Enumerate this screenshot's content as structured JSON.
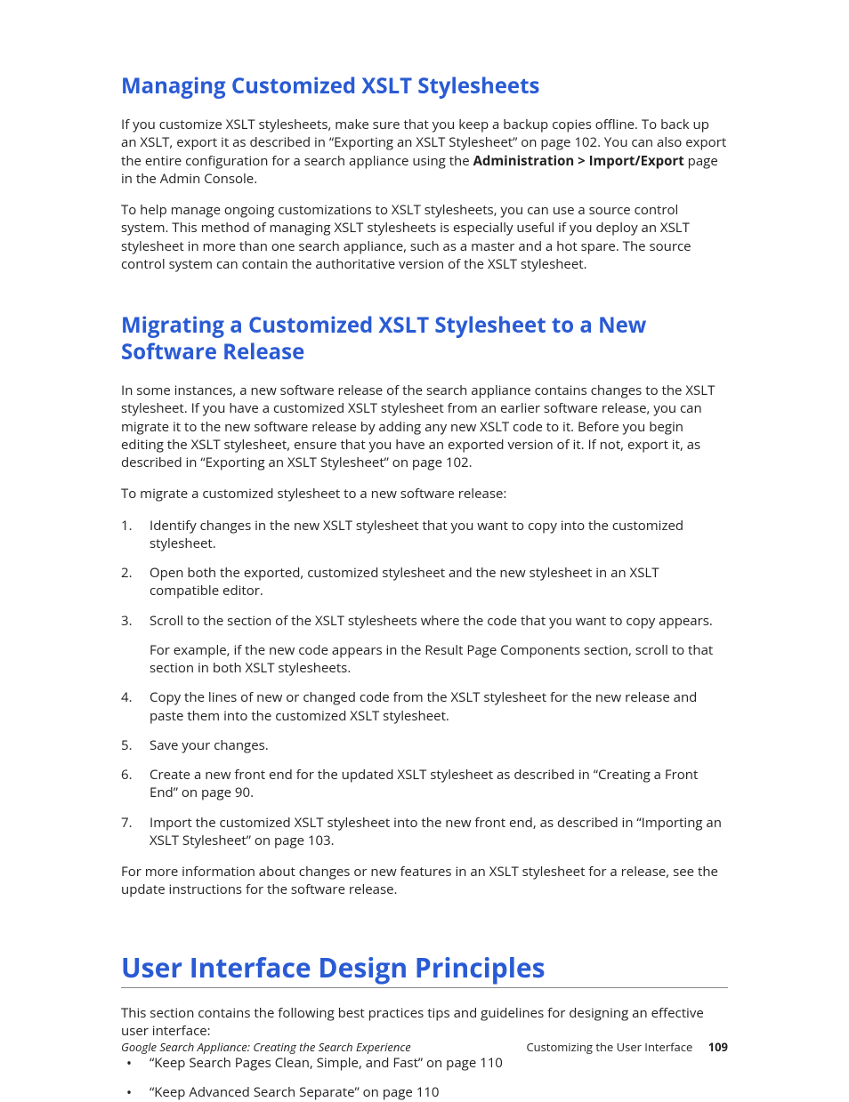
{
  "section1": {
    "heading": "Managing Customized XSLT Stylesheets",
    "para1_a": "If you customize XSLT stylesheets, make sure that you keep a backup copies offline. To back up an XSLT, export it as described in “Exporting an XSLT Stylesheet” on page 102. You can also export the entire configuration for a search appliance using the ",
    "para1_bold": "Administration > Import/Export",
    "para1_b": " page in the Admin Console.",
    "para2": "To help manage ongoing customizations to XSLT stylesheets, you can use a source control system. This method of managing XSLT stylesheets is especially useful if you deploy an XSLT stylesheet in more than one search appliance, such as a master and a hot spare. The source control system can contain the authoritative version of the XSLT stylesheet."
  },
  "section2": {
    "heading": "Migrating a Customized XSLT Stylesheet to a New Software Release",
    "para1": "In some instances, a new software release of the search appliance contains changes to the XSLT stylesheet. If you have a customized XSLT stylesheet from an earlier software release, you can migrate it to the new software release by adding any new XSLT code to it. Before you begin editing the XSLT stylesheet, ensure that you have an exported version of it. If not, export it, as described in “Exporting an XSLT Stylesheet” on page 102.",
    "para2": "To migrate a customized stylesheet to a new software release:",
    "steps": [
      {
        "text": "Identify changes in the new XSLT stylesheet that you want to copy into the customized stylesheet."
      },
      {
        "text": "Open both the exported, customized stylesheet and the new stylesheet in an XSLT compatible editor."
      },
      {
        "text": "Scroll to the section of the XSLT stylesheets where the code that you want to copy appears.",
        "subtext": "For example, if the new code appears in the Result Page Components section, scroll to that section in both XSLT stylesheets."
      },
      {
        "text": "Copy the lines of new or changed code from the XSLT stylesheet for the new release and paste them into the customized XSLT stylesheet."
      },
      {
        "text": "Save your changes."
      },
      {
        "text": "Create a new front end for the updated XSLT stylesheet as described in “Creating a Front End” on page 90."
      },
      {
        "text": "Import the customized XSLT stylesheet into the new front end, as described in “Importing an XSLT Stylesheet” on page 103."
      }
    ],
    "para3": "For more information about changes or new features in an XSLT stylesheet for a release, see the update instructions for the software release."
  },
  "section3": {
    "heading": "User Interface Design Principles",
    "para1": "This section contains the following best practices tips and guidelines for designing an effective user interface:",
    "bullets": [
      "“Keep Search Pages Clean, Simple, and Fast” on page 110",
      "“Keep Advanced Search Separate” on page 110"
    ]
  },
  "footer": {
    "left": "Google Search Appliance: Creating the Search Experience",
    "right_label": "Customizing the User Interface",
    "page": "109"
  }
}
